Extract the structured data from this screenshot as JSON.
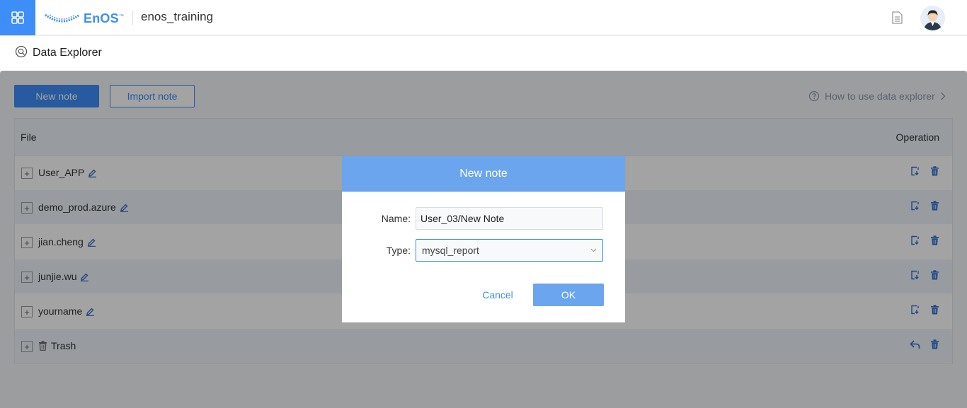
{
  "header": {
    "logo_text": "EnOS",
    "logo_tm": "™",
    "workspace": "enos_training"
  },
  "subheader": {
    "title": "Data Explorer"
  },
  "toolbar": {
    "new_note_label": "New note",
    "import_note_label": "Import note",
    "help_link": "How to use data explorer"
  },
  "table": {
    "columns": [
      "File",
      "Operation"
    ],
    "rows": [
      {
        "name": "User_APP",
        "icon": "edit-icon"
      },
      {
        "name": "demo_prod.azure",
        "icon": "edit-icon"
      },
      {
        "name": "jian.cheng",
        "icon": "edit-icon"
      },
      {
        "name": "junjie.wu",
        "icon": "edit-icon"
      },
      {
        "name": "yourname",
        "icon": "edit-icon"
      },
      {
        "name": "Trash",
        "icon": "trash-icon"
      }
    ]
  },
  "modal": {
    "title": "New note",
    "name_label": "Name:",
    "name_value": "User_03/New Note",
    "type_label": "Type:",
    "type_value": "mysql_report",
    "cancel_label": "Cancel",
    "ok_label": "OK"
  },
  "colors": {
    "accent": "#3d8ef8",
    "modal_header": "#6aa5ee",
    "overlay": "rgba(0,0,0,0.36)"
  }
}
